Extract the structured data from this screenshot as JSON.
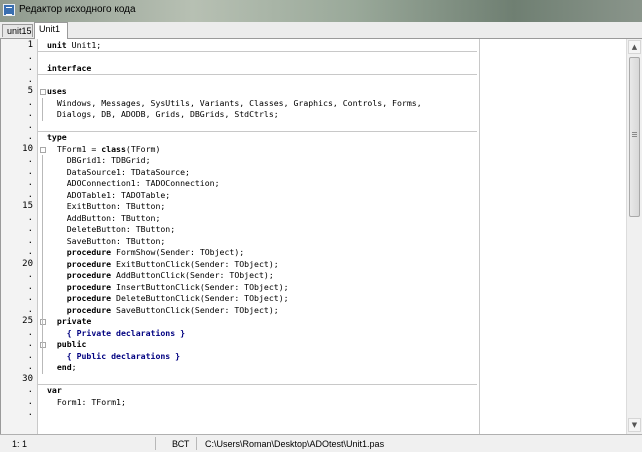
{
  "window": {
    "title": "Редактор исходного кода"
  },
  "tabs": [
    {
      "label": "unit15",
      "active": false
    },
    {
      "label": "Unit1",
      "active": true
    }
  ],
  "gutter": {
    "markers": [
      "1",
      ".",
      ".",
      ".",
      "5",
      ".",
      ".",
      ".",
      ".",
      "10",
      ".",
      ".",
      ".",
      ".",
      "15",
      ".",
      ".",
      ".",
      ".",
      "20",
      ".",
      ".",
      ".",
      ".",
      "25",
      ".",
      ".",
      ".",
      ".",
      "30",
      ".",
      ".",
      "."
    ]
  },
  "code": {
    "lines": [
      [
        {
          "t": "unit",
          "k": "kw"
        },
        {
          "t": " Unit1;",
          "k": ""
        }
      ],
      [
        {
          "t": "",
          "k": ""
        }
      ],
      [
        {
          "t": "interface",
          "k": "kw"
        }
      ],
      [
        {
          "t": "",
          "k": ""
        }
      ],
      [
        {
          "t": "uses",
          "k": "kw"
        }
      ],
      [
        {
          "t": "  Windows, Messages, SysUtils, Variants, Classes, Graphics, Controls, Forms,",
          "k": ""
        }
      ],
      [
        {
          "t": "  Dialogs, DB, ADODB, Grids, DBGrids, StdCtrls;",
          "k": ""
        }
      ],
      [
        {
          "t": "",
          "k": ""
        }
      ],
      [
        {
          "t": "type",
          "k": "kw"
        }
      ],
      [
        {
          "t": "  TForm1 = ",
          "k": ""
        },
        {
          "t": "class",
          "k": "kw"
        },
        {
          "t": "(TForm)",
          "k": ""
        }
      ],
      [
        {
          "t": "    DBGrid1: TDBGrid;",
          "k": ""
        }
      ],
      [
        {
          "t": "    DataSource1: TDataSource;",
          "k": ""
        }
      ],
      [
        {
          "t": "    ADOConnection1: TADOConnection;",
          "k": ""
        }
      ],
      [
        {
          "t": "    ADOTable1: TADOTable;",
          "k": ""
        }
      ],
      [
        {
          "t": "    ExitButton: TButton;",
          "k": ""
        }
      ],
      [
        {
          "t": "    AddButton: TButton;",
          "k": ""
        }
      ],
      [
        {
          "t": "    DeleteButton: TButton;",
          "k": ""
        }
      ],
      [
        {
          "t": "    SaveButton: TButton;",
          "k": ""
        }
      ],
      [
        {
          "t": "    ",
          "k": ""
        },
        {
          "t": "procedure",
          "k": "kw"
        },
        {
          "t": " FormShow(Sender: TObject);",
          "k": ""
        }
      ],
      [
        {
          "t": "    ",
          "k": ""
        },
        {
          "t": "procedure",
          "k": "kw"
        },
        {
          "t": " ExitButtonClick(Sender: TObject);",
          "k": ""
        }
      ],
      [
        {
          "t": "    ",
          "k": ""
        },
        {
          "t": "procedure",
          "k": "kw"
        },
        {
          "t": " AddButtonClick(Sender: TObject);",
          "k": ""
        }
      ],
      [
        {
          "t": "    ",
          "k": ""
        },
        {
          "t": "procedure",
          "k": "kw"
        },
        {
          "t": " InsertButtonClick(Sender: TObject);",
          "k": ""
        }
      ],
      [
        {
          "t": "    ",
          "k": ""
        },
        {
          "t": "procedure",
          "k": "kw"
        },
        {
          "t": " DeleteButtonClick(Sender: TObject);",
          "k": ""
        }
      ],
      [
        {
          "t": "    ",
          "k": ""
        },
        {
          "t": "procedure",
          "k": "kw"
        },
        {
          "t": " SaveButtonClick(Sender: TObject);",
          "k": ""
        }
      ],
      [
        {
          "t": "  ",
          "k": ""
        },
        {
          "t": "private",
          "k": "kw"
        }
      ],
      [
        {
          "t": "    ",
          "k": ""
        },
        {
          "t": "{ Private declarations }",
          "k": "cm"
        }
      ],
      [
        {
          "t": "  ",
          "k": ""
        },
        {
          "t": "public",
          "k": "kw"
        }
      ],
      [
        {
          "t": "    ",
          "k": ""
        },
        {
          "t": "{ Public declarations }",
          "k": "cm"
        }
      ],
      [
        {
          "t": "  ",
          "k": ""
        },
        {
          "t": "end",
          "k": "kw"
        },
        {
          "t": ";",
          "k": ""
        }
      ],
      [
        {
          "t": "",
          "k": ""
        }
      ],
      [
        {
          "t": "var",
          "k": "kw"
        }
      ],
      [
        {
          "t": "  Form1: TForm1;",
          "k": ""
        }
      ],
      [
        {
          "t": "",
          "k": ""
        }
      ]
    ]
  },
  "status": {
    "position": "1:  1",
    "mode": "ВСТ",
    "file_path": "C:\\Users\\Roman\\Desktop\\ADOtest\\Unit1.pas"
  },
  "icons": {
    "window": "editor-window-icon",
    "scroll_up": "chevron-up-icon",
    "scroll_down": "chevron-down-icon"
  }
}
